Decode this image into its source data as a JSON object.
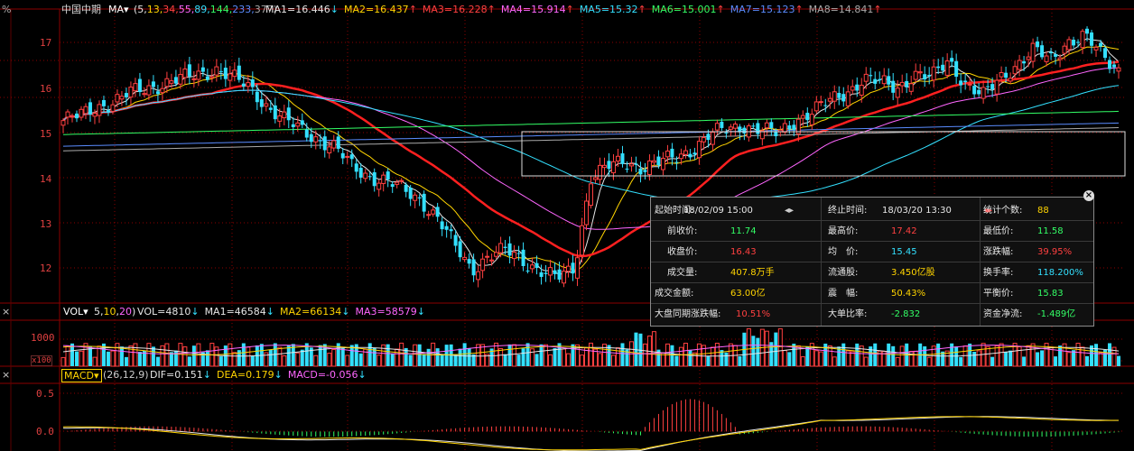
{
  "main_header": {
    "left_symbol": "%",
    "instrument": "中国中期",
    "ma_menu": "MA▾",
    "ma_params": [
      {
        "text": "(5,",
        "color": "#e6e6e6"
      },
      {
        "text": "13,",
        "color": "#ffd400"
      },
      {
        "text": "34,",
        "color": "#ff4040"
      },
      {
        "text": "55,",
        "color": "#ff66ff"
      },
      {
        "text": "89,",
        "color": "#33e0ff"
      },
      {
        "text": "144,",
        "color": "#33ff66"
      },
      {
        "text": "233,",
        "color": "#5a8cff"
      },
      {
        "text": "377)",
        "color": "#aaaaaa"
      }
    ],
    "ma_values": [
      {
        "text": "MA1=16.446",
        "arrow": "↓",
        "color": "#e6e6e6",
        "arrow_color": "#33e0ff"
      },
      {
        "text": "MA2=16.437",
        "arrow": "↑",
        "color": "#ffd400",
        "arrow_color": "#ff4040"
      },
      {
        "text": "MA3=16.228",
        "arrow": "↑",
        "color": "#ff4040",
        "arrow_color": "#ff4040"
      },
      {
        "text": "MA4=15.914",
        "arrow": "↑",
        "color": "#ff66ff",
        "arrow_color": "#ff4040"
      },
      {
        "text": "MA5=15.32",
        "arrow": "↑",
        "color": "#33e0ff",
        "arrow_color": "#ff4040"
      },
      {
        "text": "MA6=15.001",
        "arrow": "↑",
        "color": "#33ff66",
        "arrow_color": "#ff4040"
      },
      {
        "text": "MA7=15.123",
        "arrow": "↑",
        "color": "#5a8cff",
        "arrow_color": "#ff4040"
      },
      {
        "text": "MA8=14.841",
        "arrow": "↑",
        "color": "#aaaaaa",
        "arrow_color": "#ff4040"
      }
    ]
  },
  "price_axis": [
    "17",
    "16",
    "15",
    "14",
    "13",
    "12"
  ],
  "vol_header": {
    "close": "×",
    "menu": "VOL▾",
    "params_open": "(",
    "params": [
      {
        "text": "5",
        "color": "#e6e6e6"
      },
      {
        "text": ",",
        "color": "#e6e6e6"
      },
      {
        "text": "10",
        "color": "#ffd400"
      },
      {
        "text": ",",
        "color": "#e6e6e6"
      },
      {
        "text": "20",
        "color": "#ff66ff"
      },
      {
        "text": ")",
        "color": "#e6e6e6"
      }
    ],
    "values": [
      {
        "text": "VOL=4810",
        "arrow": "↓",
        "color": "#e6e6e6",
        "arrow_color": "#33e0ff"
      },
      {
        "text": "MA1=46584",
        "arrow": "↓",
        "color": "#e6e6e6",
        "arrow_color": "#33e0ff"
      },
      {
        "text": "MA2=66134",
        "arrow": "↓",
        "color": "#ffd400",
        "arrow_color": "#33e0ff"
      },
      {
        "text": "MA3=58579",
        "arrow": "↓",
        "color": "#ff66ff",
        "arrow_color": "#33e0ff"
      }
    ],
    "axis": [
      "1000",
      "500"
    ],
    "unit": "x100"
  },
  "macd_header": {
    "close": "×",
    "menu": "MACD▾",
    "params": "(26,12,9)",
    "values": [
      {
        "text": "DIF=0.151",
        "arrow": "↓",
        "color": "#e6e6e6",
        "arrow_color": "#33e0ff"
      },
      {
        "text": "DEA=0.179",
        "arrow": "↓",
        "color": "#ffd400",
        "arrow_color": "#33e0ff"
      },
      {
        "text": "MACD=-0.056",
        "arrow": "↓",
        "color": "#ff66ff",
        "arrow_color": "#33e0ff"
      }
    ],
    "axis": [
      "0.5",
      "0.0"
    ]
  },
  "stats": {
    "close": "×",
    "rows": [
      [
        {
          "key": "起始时间:",
          "value": "18/02/09 15:00",
          "vcolor": "#e8e8e8",
          "extra": "◂▸"
        },
        {
          "key": "终止时间:",
          "value": "18/03/20 13:30",
          "vcolor": "#e8e8e8",
          "extra": "◂▸"
        },
        {
          "key": "统计个数:",
          "value": "88",
          "vcolor": "#ffd400"
        }
      ],
      [
        {
          "key": "前收价:",
          "value": "11.74",
          "vcolor": "#33ff66"
        },
        {
          "key": "最高价:",
          "value": "17.42",
          "vcolor": "#ff4040"
        },
        {
          "key": "最低价:",
          "value": "11.58",
          "vcolor": "#33ff66"
        }
      ],
      [
        {
          "key": "收盘价:",
          "value": "16.43",
          "vcolor": "#ff4040"
        },
        {
          "key": "均　价:",
          "value": "15.45",
          "vcolor": "#33e0ff"
        },
        {
          "key": "涨跌幅:",
          "value": "39.95%",
          "vcolor": "#ff4040"
        }
      ],
      [
        {
          "key": "成交量:",
          "value": "407.8万手",
          "vcolor": "#ffd400"
        },
        {
          "key": "流通股:",
          "value": "3.450亿股",
          "vcolor": "#ffd400"
        },
        {
          "key": "换手率:",
          "value": "118.200%",
          "vcolor": "#33e0ff"
        }
      ],
      [
        {
          "key": "成交金额:",
          "value": "63.00亿",
          "vcolor": "#ffd400"
        },
        {
          "key": "震　幅:",
          "value": "50.43%",
          "vcolor": "#ffd400"
        },
        {
          "key": "平衡价:",
          "value": "15.83",
          "vcolor": "#33ff66"
        }
      ],
      [
        {
          "key": "大盘同期涨跌幅:",
          "value": "10.51%",
          "vcolor": "#ff4040"
        },
        {
          "key": "大单比率:",
          "value": "-2.832",
          "vcolor": "#33ff66"
        },
        {
          "key": "资金净流:",
          "value": "-1.489亿",
          "vcolor": "#33ff66"
        }
      ]
    ]
  },
  "chart_data": {
    "type": "candlestick",
    "x": [
      "",
      "",
      ""
    ],
    "price_range": [
      11.4,
      17.4
    ],
    "series_approx": [
      {
        "name": "MA1",
        "color": "#e6e6e6"
      },
      {
        "name": "MA2",
        "color": "#ffd400"
      },
      {
        "name": "MA3",
        "color": "#ff2020"
      },
      {
        "name": "MA4",
        "color": "#ff66ff"
      },
      {
        "name": "MA5",
        "color": "#33e0ff"
      },
      {
        "name": "MA6",
        "color": "#33ff66"
      },
      {
        "name": "MA7",
        "color": "#5a8cff"
      },
      {
        "name": "MA8",
        "color": "#aaaaaa"
      }
    ],
    "closes": [
      15.2,
      15.3,
      15.5,
      15.6,
      15.8,
      15.9,
      16.0,
      16.1,
      16.2,
      16.3,
      16.1,
      15.9,
      15.5,
      15.2,
      15.0,
      14.8,
      14.6,
      14.2,
      14.0,
      13.9,
      13.7,
      13.5,
      13.1,
      12.5,
      12.0,
      12.3,
      12.4,
      12.2,
      12.0,
      11.8,
      12.0,
      14.0,
      14.2,
      14.3,
      14.2,
      14.3,
      14.4,
      14.6,
      14.9,
      15.0,
      15.1,
      15.0,
      14.9,
      15.2,
      15.4,
      15.6,
      15.8,
      16.1,
      16.0,
      15.9,
      16.2,
      16.1,
      16.5,
      16.0,
      15.7,
      16.1,
      16.4,
      16.7,
      16.5,
      16.9,
      17.0,
      16.6,
      16.3
    ],
    "vol_range": [
      0,
      1500
    ],
    "macd_range": [
      -0.3,
      0.7
    ]
  }
}
